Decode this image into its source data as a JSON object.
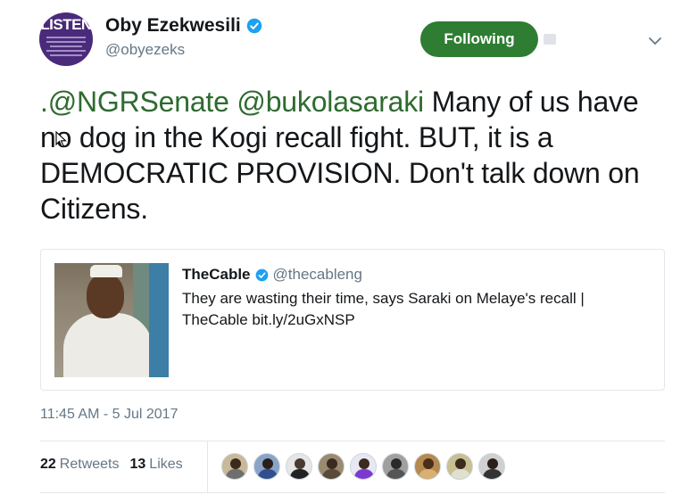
{
  "author": {
    "avatar_text": "LISTEN",
    "name": "Oby Ezekwesili",
    "handle": "@obyezeks"
  },
  "follow_button": {
    "label": "Following"
  },
  "tweet": {
    "mention_1": ".@NGRSenate",
    "mention_2": "@bukolasaraki",
    "body": " Many of us have no dog in the Kogi recall fight. BUT, it is a DEMOCRATIC PROVISION. Don't talk down on Citizens."
  },
  "quoted": {
    "author": "TheCable",
    "handle": "@thecableng",
    "text": "They are wasting their time, says Saraki on Melaye's recall | TheCable bit.ly/2uGxNSP"
  },
  "timestamp": "11:45 AM - 5 Jul 2017",
  "stats": {
    "retweets_count": "22",
    "retweets_label": "Retweets",
    "likes_count": "13",
    "likes_label": "Likes"
  },
  "likers": [
    {
      "bg": "#c9b89a",
      "head": "#3b2a1e",
      "body": "#6e6e6e"
    },
    {
      "bg": "#8aa4c8",
      "head": "#2a1f1a",
      "body": "#2f4f8f"
    },
    {
      "bg": "#e6e6e6",
      "head": "#4a3a30",
      "body": "#222222"
    },
    {
      "bg": "#9a8a70",
      "head": "#3a2a20",
      "body": "#5a4a3a"
    },
    {
      "bg": "#e8e8f5",
      "head": "#3b2a1e",
      "body": "#7a3ad0"
    },
    {
      "bg": "#a0a0a0",
      "head": "#2a2a2a",
      "body": "#555555"
    },
    {
      "bg": "#b58a50",
      "head": "#4a2e1a",
      "body": "#d9b070"
    },
    {
      "bg": "#c8c090",
      "head": "#3b2a1e",
      "body": "#e0e0d0"
    },
    {
      "bg": "#d0d0d0",
      "head": "#2a1f1a",
      "body": "#333333"
    }
  ],
  "colors": {
    "accent": "#2e7d32",
    "mention": "#2e6b30",
    "verified": "#1da1f2",
    "muted": "#657786"
  }
}
